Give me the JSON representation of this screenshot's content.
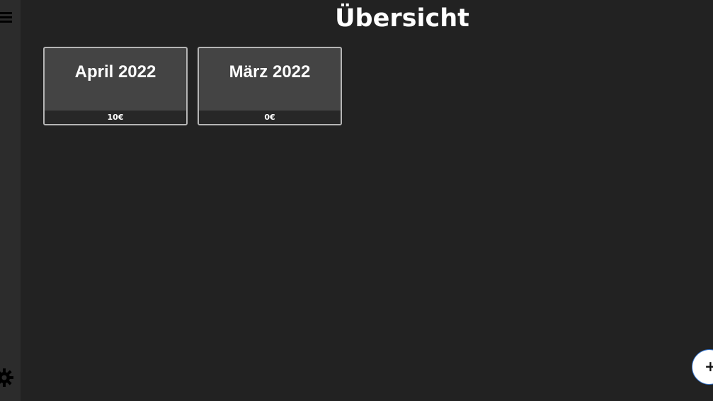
{
  "header": {
    "title": "Übersicht"
  },
  "sidebar": {
    "menu_icon": "hamburger-menu-icon",
    "settings_icon": "gear-icon"
  },
  "months": [
    {
      "title": "April 2022",
      "total": "10€"
    },
    {
      "title": "März 2022",
      "total": "0€"
    }
  ],
  "fab": {
    "label": "+",
    "icon": "plus-icon"
  },
  "colors": {
    "background": "#222222",
    "sidebar": "#2c2c2c",
    "card": "#444444",
    "card_border": "#b5b5b5",
    "card_footer": "#272727",
    "text": "#ffffff"
  }
}
